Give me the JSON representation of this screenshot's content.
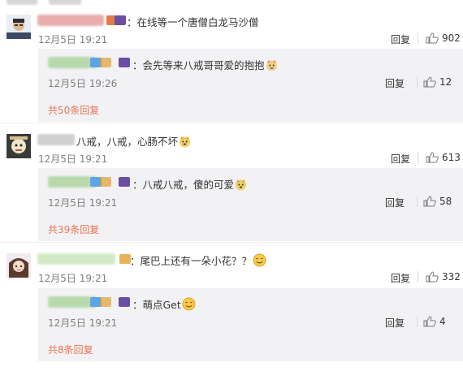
{
  "top": {
    "partial_left": "按热度",
    "partial_right": "按时间"
  },
  "thread1": {
    "comment_text": "：在线等一个唐僧白龙马沙僧",
    "date": "12月5日 19:21",
    "reply_label": "回复",
    "likes": "902",
    "sub": {
      "text": "：会先等来八戒哥哥爱的抱抱",
      "date": "12月5日 19:26",
      "reply_label": "回复",
      "likes": "12"
    },
    "more_replies": "共50条回复"
  },
  "thread2": {
    "comment_text": "八戒，八戒，心肠不坏",
    "date": "12月5日 19:21",
    "reply_label": "回复",
    "likes": "613",
    "sub": {
      "text": "：八戒八戒，傻的可爱",
      "date": "12月5日 19:21",
      "reply_label": "回复",
      "likes": "58"
    },
    "more_replies": "共39条回复"
  },
  "thread3": {
    "comment_text": "：尾巴上还有一朵小花？？",
    "date": "12月5日 19:21",
    "reply_label": "回复",
    "likes": "332",
    "sub": {
      "text": "：萌点Get",
      "date": "12月5日 19:21",
      "reply_label": "回复",
      "likes": "4"
    },
    "more_replies": "共8条回复"
  }
}
